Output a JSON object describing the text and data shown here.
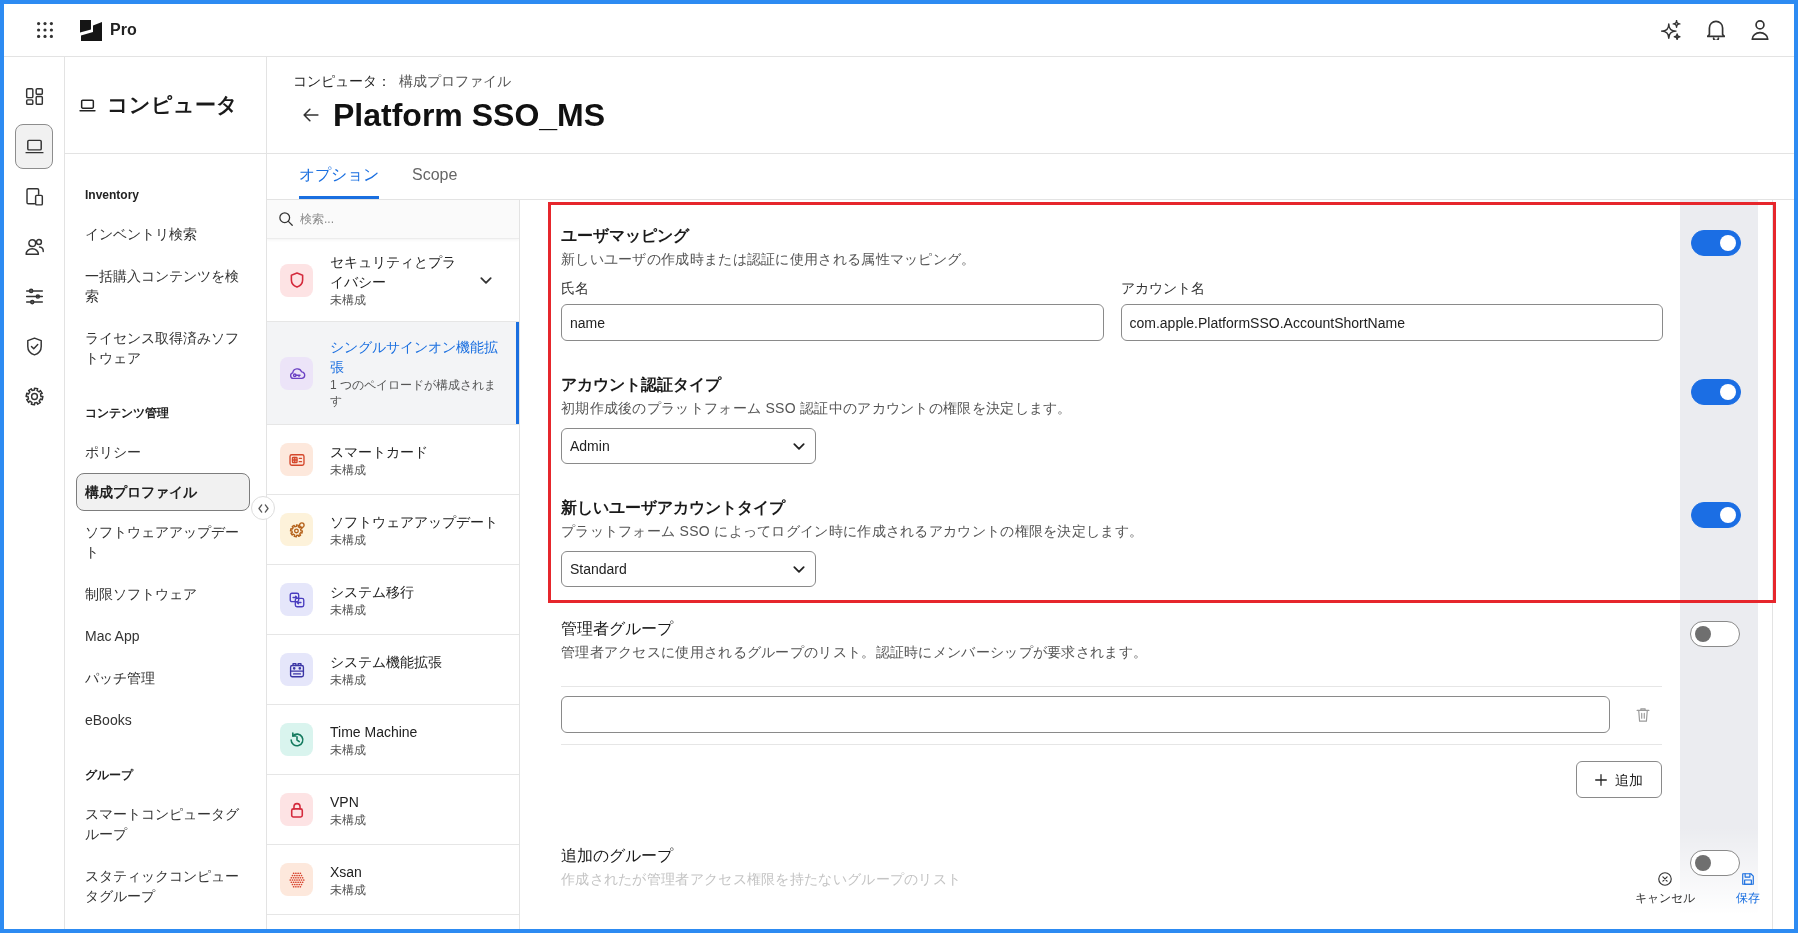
{
  "topbar": {
    "product": "Pro"
  },
  "rail": [
    {
      "kind": "dashboard",
      "selected": false
    },
    {
      "kind": "computer",
      "selected": true
    },
    {
      "kind": "devices",
      "selected": false
    },
    {
      "kind": "users",
      "selected": false
    },
    {
      "kind": "sliders",
      "selected": false
    },
    {
      "kind": "security",
      "selected": false
    },
    {
      "kind": "settings",
      "selected": false
    }
  ],
  "sidebar": {
    "title": "コンピュータ",
    "sections": [
      {
        "heading": "Inventory",
        "items": [
          {
            "label": "インベントリ検索",
            "selected": false
          },
          {
            "label": "一括購入コンテンツを検索",
            "selected": false
          },
          {
            "label": "ライセンス取得済みソフトウェア",
            "selected": false
          }
        ]
      },
      {
        "heading": "コンテンツ管理",
        "items": [
          {
            "label": "ポリシー",
            "selected": false
          },
          {
            "label": "構成プロファイル",
            "selected": true
          },
          {
            "label": "ソフトウェアアップデート",
            "selected": false
          },
          {
            "label": "制限ソフトウェア",
            "selected": false
          },
          {
            "label": "Mac App",
            "selected": false
          },
          {
            "label": "パッチ管理",
            "selected": false
          },
          {
            "label": "eBooks",
            "selected": false
          }
        ]
      },
      {
        "heading": "グループ",
        "items": [
          {
            "label": "スマートコンピュータグループ",
            "selected": false
          },
          {
            "label": "スタティックコンピュータグループ",
            "selected": false
          }
        ]
      }
    ]
  },
  "page": {
    "breadcrumb": {
      "parent": "コンピュータ：",
      "current": "構成プロファイル"
    },
    "title": "Platform SSO_MS"
  },
  "tabs": [
    {
      "label": "オプション",
      "selected": true
    },
    {
      "label": "Scope",
      "selected": false
    }
  ],
  "payloads": {
    "search": {
      "placeholder": "検索..."
    },
    "items": [
      {
        "kind": "security",
        "name": "セキュリティとプライバシー",
        "status": "未構成",
        "expandable": true,
        "selected": false
      },
      {
        "kind": "sso",
        "name": "シングルサインオン機能拡張",
        "status": "1 つのペイロードが構成されます",
        "expandable": false,
        "selected": true
      },
      {
        "kind": "smartcard",
        "name": "スマートカード",
        "status": "未構成",
        "expandable": false,
        "selected": false
      },
      {
        "kind": "update",
        "name": "ソフトウェアアップデート",
        "status": "未構成",
        "expandable": false,
        "selected": false
      },
      {
        "kind": "migration",
        "name": "システム移行",
        "status": "未構成",
        "expandable": false,
        "selected": false
      },
      {
        "kind": "extension",
        "name": "システム機能拡張",
        "status": "未構成",
        "expandable": false,
        "selected": false
      },
      {
        "kind": "timemachine",
        "name": "Time Machine",
        "status": "未構成",
        "expandable": false,
        "selected": false
      },
      {
        "kind": "vpn",
        "name": "VPN",
        "status": "未構成",
        "expandable": false,
        "selected": false
      },
      {
        "kind": "xsan",
        "name": "Xsan",
        "status": "未構成",
        "expandable": false,
        "selected": false
      }
    ]
  },
  "settings": [
    {
      "kind": "fields",
      "title": "ユーザマッピング",
      "description": "新しいユーザの作成時または認証に使用される属性マッピング。",
      "on": true,
      "highlighted": true,
      "fields": [
        {
          "label": "氏名",
          "value": "name"
        },
        {
          "label": "アカウント名",
          "value": "com.apple.PlatformSSO.AccountShortName"
        }
      ]
    },
    {
      "kind": "select",
      "title": "アカウント認証タイプ",
      "description": "初期作成後のプラットフォーム SSO 認証中のアカウントの権限を決定します。",
      "on": true,
      "highlighted": true,
      "value": "Admin"
    },
    {
      "kind": "select",
      "title": "新しいユーザアカウントタイプ",
      "description": "プラットフォーム SSO によってログイン時に作成されるアカウントの権限を決定します。",
      "on": true,
      "highlighted": true,
      "value": "Standard"
    },
    {
      "kind": "list",
      "title": "管理者グループ",
      "description": "管理者アクセスに使用されるグループのリスト。認証時にメンバーシップが要求されます。",
      "on": false,
      "highlighted": false,
      "add_label": "追加"
    },
    {
      "kind": "plain",
      "title": "追加のグループ",
      "description": "作成されたが管理者アクセス権限を持たないグループのリスト",
      "on": false,
      "highlighted": false
    }
  ],
  "actions": [
    {
      "kind": "cancel",
      "label": "キャンセル"
    },
    {
      "kind": "save",
      "label": "保存"
    }
  ]
}
